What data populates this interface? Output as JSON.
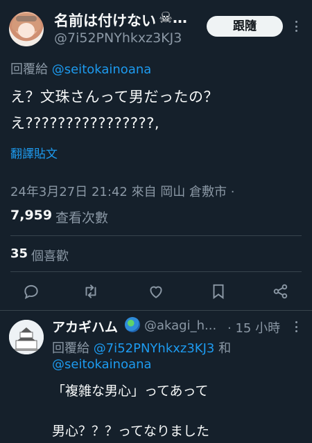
{
  "colors": {
    "background": "#15202b",
    "accent": "#1d9bf0",
    "muted": "#8b98a5",
    "text": "#f7f9f9"
  },
  "post": {
    "display_name": "名前は付けない",
    "name_ellipsis": "…",
    "name_emoji_icon": "skull-crossbones-icon",
    "handle": "@7i52PNYhkxz3KJ3",
    "follow_label": "跟隨",
    "reply_prefix": "回覆給",
    "reply_mention": "@seitokainoana",
    "text_line_1": "え？文珠さんって男だったの？",
    "text_line_2": "え????????????????,",
    "translate_label": "翻譯貼文",
    "timestamp": "24年3月27日 21:42 來自 岡山 倉敷市 ·",
    "views_count": "7,959",
    "views_label": "查看次數",
    "likes_count": "35",
    "likes_label": "個喜歡",
    "actions": [
      "reply-icon",
      "retweet-icon",
      "like-icon",
      "bookmark-icon",
      "share-icon"
    ]
  },
  "reply": {
    "display_name": "アカギハム",
    "name_emoji_icon": "globe-icon",
    "handle": "@akagi_h...",
    "time": "· 15 小時",
    "reply_prefix": "回覆給",
    "reply_mention_1": "@7i52PNYhkxz3KJ3",
    "reply_and": "和",
    "reply_mention_2": "@seitokainoana",
    "text_line_1": "「複雑な男心」ってあって",
    "text_line_2": "男心？？？ってなりました"
  }
}
